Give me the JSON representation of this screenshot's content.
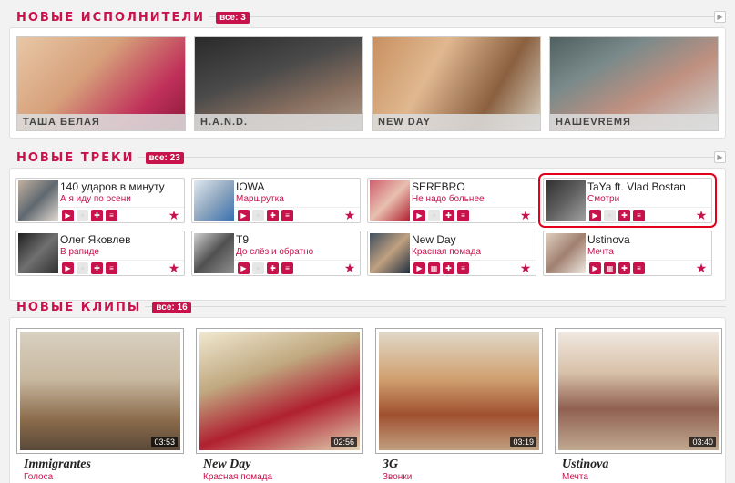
{
  "artists_section": {
    "title": "Новые исполнители",
    "count": "все: 3",
    "items": [
      {
        "name": "ТАША БЕЛАЯ"
      },
      {
        "name": "H.A.N.D."
      },
      {
        "name": "NEW DAY"
      },
      {
        "name": "НАШЕVREMЯ"
      }
    ]
  },
  "tracks_section": {
    "title": "Новые треки",
    "count": "все: 23",
    "items": [
      {
        "artist": "140 ударов в минуту",
        "song": "А я иду по осени"
      },
      {
        "artist": "IOWA",
        "song": "Маршрутка"
      },
      {
        "artist": "SEREBRO",
        "song": "Не надо больнее"
      },
      {
        "artist": "TaYa ft. Vlad Bostan",
        "song": "Смотри"
      },
      {
        "artist": "Олег Яковлев",
        "song": "В рапиде"
      },
      {
        "artist": "Т9",
        "song": "До слёз и обратно"
      },
      {
        "artist": "New Day",
        "song": "Красная помада"
      },
      {
        "artist": "Ustinova",
        "song": "Мечта"
      }
    ]
  },
  "clips_section": {
    "title": "Новые клипы",
    "count": "все: 16",
    "items": [
      {
        "title": "Immigrantes",
        "artist": "Голоса",
        "duration": "03:53"
      },
      {
        "title": "New Day",
        "artist": "Красная помада",
        "duration": "02:56"
      },
      {
        "title": "3G",
        "artist": "Звонки",
        "duration": "03:19"
      },
      {
        "title": "Ustinova",
        "artist": "Мечта",
        "duration": "03:40"
      }
    ]
  },
  "colors": {
    "accent": "#c8124c",
    "highlight": "#e3001b"
  }
}
